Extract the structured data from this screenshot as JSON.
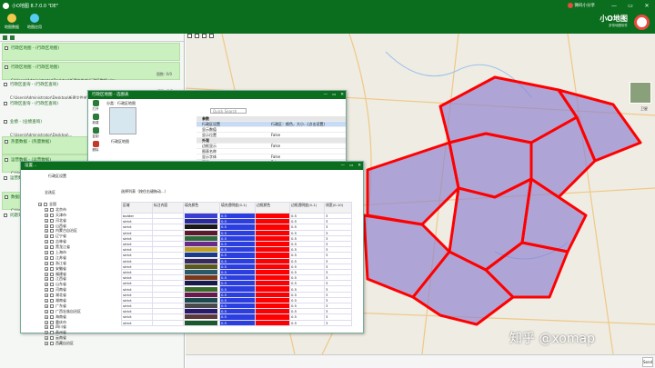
{
  "titlebar": {
    "title": "小O地图 8.7.0.0 \"DE\"",
    "user": "微码小分享",
    "controls": [
      "—",
      "▭",
      "✕"
    ]
  },
  "ribbon": {
    "buttons": [
      {
        "label": "地图数据",
        "icon": "globe-icon",
        "color": "#f2c94c"
      },
      {
        "label": "地图应用",
        "icon": "app-icon",
        "color": "#56ccf2"
      }
    ],
    "brand_name": "小O地图",
    "brand_sub": "多快地图软件"
  },
  "left_panel": {
    "layers": [
      {
        "name": "行政区地图 - (行政区地图)",
        "count": "",
        "path": "",
        "highlighted": true
      },
      {
        "name": "行政区地图 - (行政区地图)",
        "count": "图数: 0/0",
        "path": "C:\\Users\\Administrator\\Desktop\\新建文件夹\\行政区数据.xlsx",
        "highlighted": true
      },
      {
        "name": "行政区查询 - (行政区查询)",
        "count": "图数: 0/0",
        "path": "C:\\Users\\Administrator\\Desktop\\新建文件夹\\行政区数据.xlsx",
        "highlighted": false
      },
      {
        "name": "行政区查询 - (行政区查询)",
        "count": "",
        "path": "",
        "highlighted": false
      },
      {
        "name": "业绩 - (业绩查询)",
        "count": "",
        "path": "C:\\Users\\Administrator\\Desktop\\...",
        "highlighted": false
      },
      {
        "name": "热量数据 - (热量数据)",
        "count": "",
        "path": "",
        "highlighted": true
      },
      {
        "name": "运营数据 - (运营数据)",
        "count": "",
        "path": "C:\\Users\\Administrator\\Desktop\\...",
        "highlighted": true
      },
      {
        "name": "运营数据 - (运营数据)",
        "count": "",
        "path": "",
        "highlighted": false
      },
      {
        "name": "数据视频 - (视频数据)",
        "count": "",
        "path": "C:\\Users\\Administrator\\Desktop\\...",
        "highlighted": true
      },
      {
        "name": "问题对象 - (问题对象)",
        "count": "",
        "path": "",
        "highlighted": false
      }
    ]
  },
  "dialog1": {
    "title": "行政区地图 - 选图表",
    "breadcrumb": "分类：行政区地图",
    "tools": [
      "打开",
      "新建",
      "复制",
      "删除"
    ],
    "thumb_label": "行政区地图",
    "search_placeholder": "Quick Search",
    "props": [
      {
        "k": "参数",
        "v": "",
        "type": "hdr"
      },
      {
        "k": "行政区设置",
        "v": "行政区：颜色，大小...(点击设置)",
        "type": "sel"
      },
      {
        "k": "显示数值",
        "v": "",
        "type": ""
      },
      {
        "k": "显示位置",
        "v": "False",
        "type": ""
      },
      {
        "k": "外观",
        "v": "",
        "type": "hdr"
      },
      {
        "k": "边框显示",
        "v": "False",
        "type": ""
      },
      {
        "k": "图表名称",
        "v": "",
        "type": ""
      },
      {
        "k": "显示字体",
        "v": "False",
        "type": ""
      },
      {
        "k": "图例",
        "v": "False",
        "type": ""
      }
    ]
  },
  "dialog2": {
    "title": "设置...",
    "label1": "行政区设置",
    "label2": "选择列表（按住右键拖动...）",
    "label3": "全选区",
    "tree": [
      "全国",
      "北京市",
      "天津市",
      "河北省",
      "山西省",
      "内蒙古自治区",
      "辽宁省",
      "吉林省",
      "黑龙江省",
      "上海市",
      "江苏省",
      "浙江省",
      "安徽省",
      "福建省",
      "江西省",
      "山东省",
      "河南省",
      "湖北省",
      "湖南省",
      "广东省",
      "广西壮族自治区",
      "海南省",
      "重庆市",
      "四川省",
      "贵州省",
      "云南省",
      "西藏自治区"
    ],
    "columns": [
      "区域",
      "标注内容",
      "填充颜色",
      "填充透明度(0-1)",
      "边框颜色",
      "边框透明度(0-1)",
      "线宽(0-10)"
    ],
    "rows": [
      {
        "name": "bolder",
        "label": "",
        "fill": "#3a3fd1",
        "fa": "0.5",
        "stroke": "#ff0000",
        "sa": "0.5",
        "lw": "3"
      },
      {
        "name": "strict",
        "label": "",
        "fill": "#2a2a9a",
        "fa": "0.5",
        "stroke": "#ff0000",
        "sa": "0.5",
        "lw": "3"
      },
      {
        "name": "strict",
        "label": "",
        "fill": "#1a1a1a",
        "fa": "0.5",
        "stroke": "#ff0000",
        "sa": "0.5",
        "lw": "3"
      },
      {
        "name": "strict",
        "label": "",
        "fill": "#5a1a2a",
        "fa": "0.5",
        "stroke": "#ff0000",
        "sa": "0.5",
        "lw": "3"
      },
      {
        "name": "strict",
        "label": "",
        "fill": "#2f6a3a",
        "fa": "0.5",
        "stroke": "#ff0000",
        "sa": "0.5",
        "lw": "3"
      },
      {
        "name": "strict",
        "label": "",
        "fill": "#6a2a8a",
        "fa": "0.5",
        "stroke": "#ff0000",
        "sa": "0.5",
        "lw": "3"
      },
      {
        "name": "strict",
        "label": "",
        "fill": "#c0a020",
        "fa": "0.5",
        "stroke": "#ff0000",
        "sa": "0.5",
        "lw": "3"
      },
      {
        "name": "strict",
        "label": "",
        "fill": "#1a3a8a",
        "fa": "0.5",
        "stroke": "#ff0000",
        "sa": "0.5",
        "lw": "3"
      },
      {
        "name": "strict",
        "label": "",
        "fill": "#3a2a5a",
        "fa": "0.5",
        "stroke": "#ff0000",
        "sa": "0.5",
        "lw": "3"
      },
      {
        "name": "strict",
        "label": "",
        "fill": "#5a5a1a",
        "fa": "0.5",
        "stroke": "#ff0000",
        "sa": "0.5",
        "lw": "3"
      },
      {
        "name": "strict",
        "label": "",
        "fill": "#2a5a6a",
        "fa": "0.5",
        "stroke": "#ff0000",
        "sa": "0.5",
        "lw": "3"
      },
      {
        "name": "strict",
        "label": "",
        "fill": "#7a3a1a",
        "fa": "0.5",
        "stroke": "#ff0000",
        "sa": "0.5",
        "lw": "3"
      },
      {
        "name": "strict",
        "label": "",
        "fill": "#1a1a4a",
        "fa": "0.5",
        "stroke": "#ff0000",
        "sa": "0.5",
        "lw": "3"
      },
      {
        "name": "strict",
        "label": "",
        "fill": "#3a6a2a",
        "fa": "0.5",
        "stroke": "#ff0000",
        "sa": "0.5",
        "lw": "3"
      },
      {
        "name": "strict",
        "label": "",
        "fill": "#6a1a4a",
        "fa": "0.5",
        "stroke": "#ff0000",
        "sa": "0.5",
        "lw": "3"
      },
      {
        "name": "strict",
        "label": "",
        "fill": "#1a4a4a",
        "fa": "0.5",
        "stroke": "#ff0000",
        "sa": "0.5",
        "lw": "3"
      },
      {
        "name": "strict",
        "label": "",
        "fill": "#4a4a4a",
        "fa": "0.5",
        "stroke": "#ff0000",
        "sa": "0.5",
        "lw": "3"
      },
      {
        "name": "strict",
        "label": "",
        "fill": "#2a1a6a",
        "fa": "0.5",
        "stroke": "#ff0000",
        "sa": "0.5",
        "lw": "3"
      },
      {
        "name": "strict",
        "label": "",
        "fill": "#5a3a3a",
        "fa": "0.5",
        "stroke": "#ff0000",
        "sa": "0.5",
        "lw": "3"
      },
      {
        "name": "strict",
        "label": "",
        "fill": "#1a5a2a",
        "fa": "0.5",
        "stroke": "#ff0000",
        "sa": "0.5",
        "lw": "3"
      }
    ]
  },
  "map": {
    "minimap_label": "卫星",
    "watermark": "知乎 @xomap",
    "send_label": "Send",
    "region_fill": "#8a7fd0",
    "region_stroke": "#ff0000"
  }
}
